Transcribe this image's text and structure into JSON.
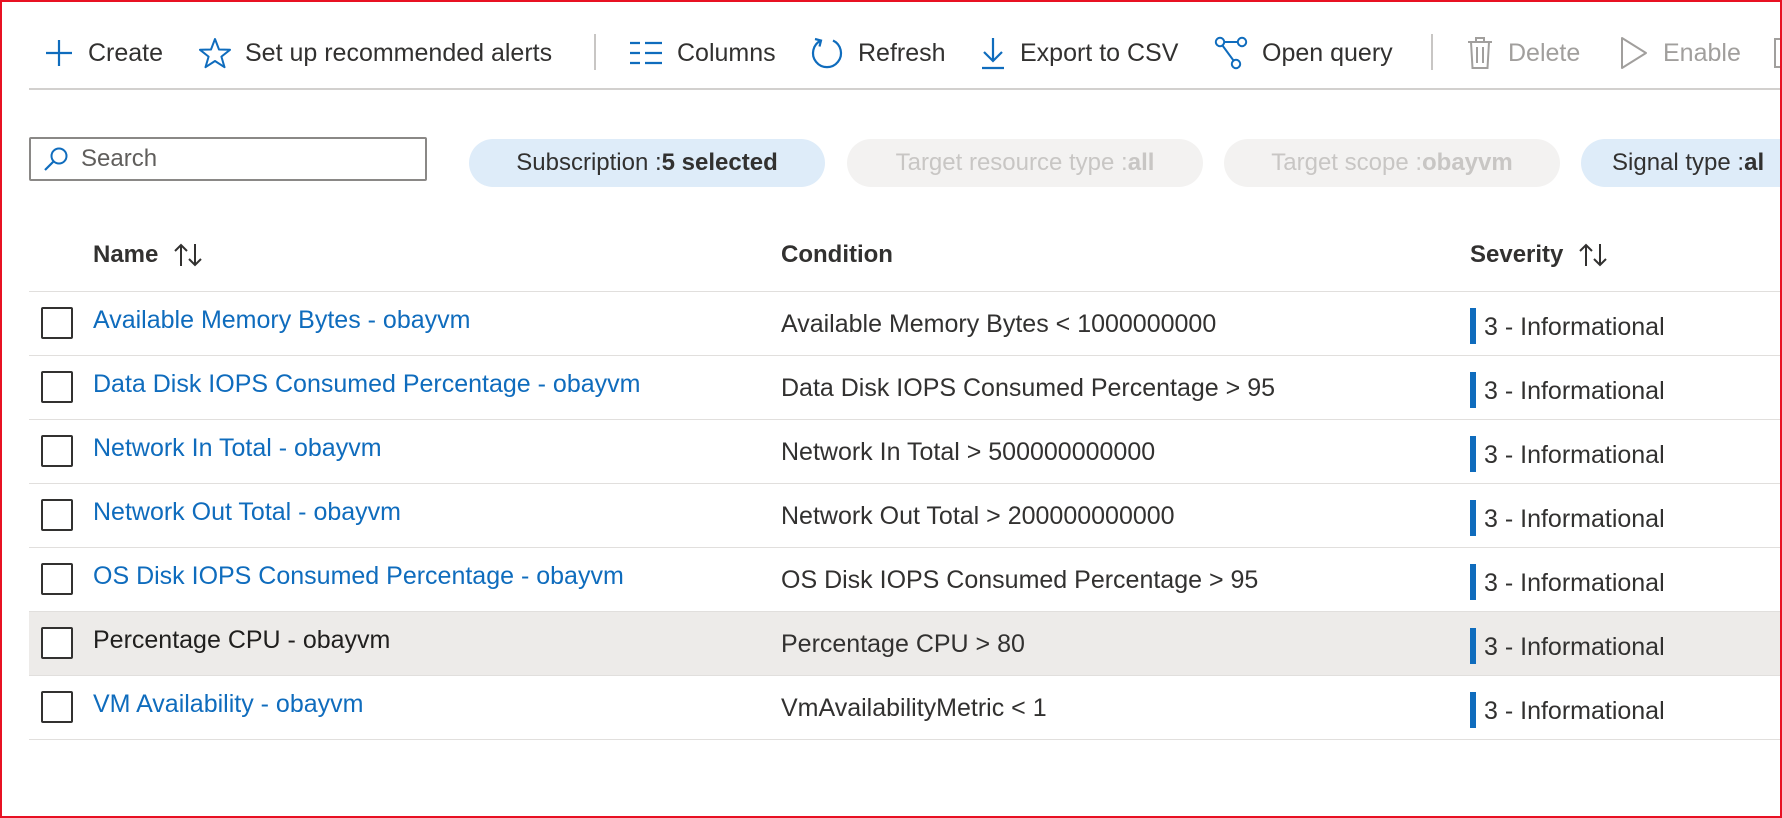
{
  "toolbar": {
    "create": "Create",
    "setup_alerts": "Set up recommended alerts",
    "columns": "Columns",
    "refresh": "Refresh",
    "export_csv": "Export to CSV",
    "open_query": "Open query",
    "delete": "Delete",
    "enable": "Enable"
  },
  "search": {
    "placeholder": "Search"
  },
  "filters": [
    {
      "label": "Subscription : ",
      "value": "5 selected",
      "state": "active"
    },
    {
      "label": "Target resource type : ",
      "value": "all",
      "state": "inactive"
    },
    {
      "label": "Target scope : ",
      "value": "obayvm",
      "state": "inactive"
    },
    {
      "label": "Signal type : ",
      "value": "al",
      "state": "active"
    }
  ],
  "table": {
    "headers": {
      "name": "Name",
      "condition": "Condition",
      "severity": "Severity"
    },
    "rows": [
      {
        "name": "Available Memory Bytes - obayvm",
        "condition": "Available Memory Bytes < 1000000000",
        "severity": "3 - Informational"
      },
      {
        "name": "Data Disk IOPS Consumed Percentage - obayvm",
        "condition": "Data Disk IOPS Consumed Percentage > 95",
        "severity": "3 - Informational"
      },
      {
        "name": "Network In Total - obayvm",
        "condition": "Network In Total > 500000000000",
        "severity": "3 - Informational"
      },
      {
        "name": "Network Out Total - obayvm",
        "condition": "Network Out Total > 200000000000",
        "severity": "3 - Informational"
      },
      {
        "name": "OS Disk IOPS Consumed Percentage - obayvm",
        "condition": "OS Disk IOPS Consumed Percentage > 95",
        "severity": "3 - Informational"
      },
      {
        "name": "Percentage CPU - obayvm",
        "condition": "Percentage CPU > 80",
        "severity": "3 - Informational"
      },
      {
        "name": "VM Availability - obayvm",
        "condition": "VmAvailabilityMetric < 1",
        "severity": "3 - Informational"
      }
    ]
  },
  "colors": {
    "link": "#0f6cbd",
    "severity_bar": "#0f6cbd",
    "frame_border": "#e81123"
  }
}
